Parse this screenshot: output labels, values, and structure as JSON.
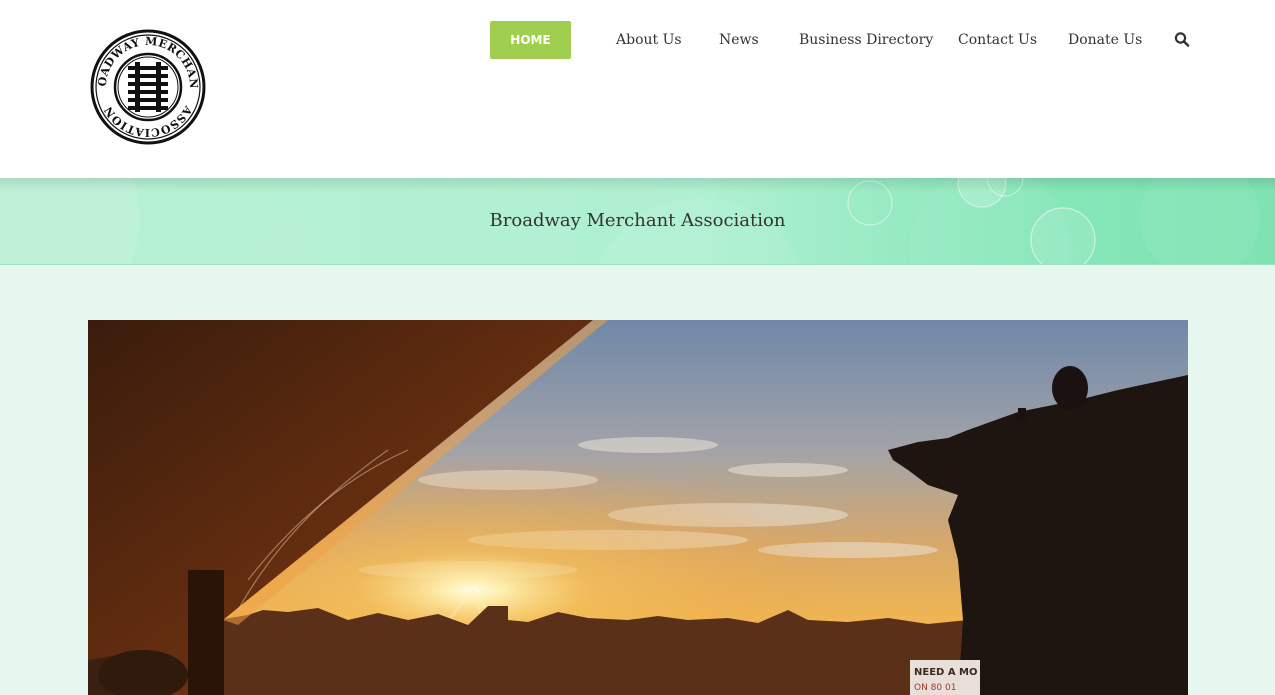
{
  "nav": {
    "home": "HOME",
    "items": [
      "About Us",
      "News",
      "Business Directory",
      "Contact Us",
      "Donate Us"
    ],
    "search_icon": "search-icon"
  },
  "logo": {
    "text_top": "BROADWAY MERCHANTS",
    "text_right": "ASSOCIATION",
    "icon": "railroad-track-icon"
  },
  "banner": {
    "title": "Broadway Merchant Association"
  },
  "hero": {
    "sign_text": "NEED A MO",
    "sign_sub": "ON 80 01"
  },
  "colors": {
    "accent": "#a0ce4e",
    "banner": "#b8f0d4",
    "background": "#e6f7ef"
  }
}
